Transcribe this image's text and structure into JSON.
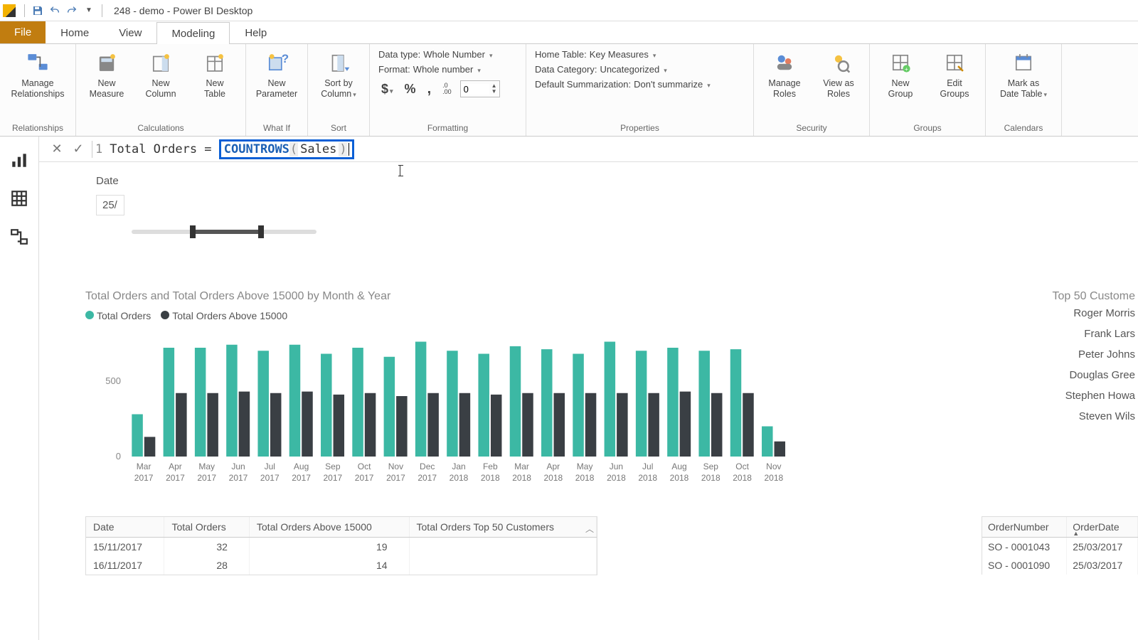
{
  "title": "248 - demo - Power BI Desktop",
  "menu": {
    "file": "File",
    "tabs": [
      "Home",
      "View",
      "Modeling",
      "Help"
    ],
    "active": "Modeling"
  },
  "ribbon": {
    "relationships": {
      "manage": "Manage\nRelationships",
      "label": "Relationships"
    },
    "calculations": {
      "measure": "New\nMeasure",
      "column": "New\nColumn",
      "table": "New\nTable",
      "label": "Calculations"
    },
    "whatif": {
      "param": "New\nParameter",
      "label": "What If"
    },
    "sort": {
      "sortby": "Sort by\nColumn",
      "label": "Sort"
    },
    "formatting": {
      "datatype_lbl": "Data type:",
      "datatype_val": "Whole Number",
      "format_lbl": "Format:",
      "format_val": "Whole number",
      "currency": "$",
      "percent": "%",
      "comma": ",",
      "dec_icon": ".0\n.00",
      "dec_val": "0",
      "label": "Formatting"
    },
    "properties": {
      "home_lbl": "Home Table:",
      "home_val": "Key Measures",
      "cat_lbl": "Data Category:",
      "cat_val": "Uncategorized",
      "sum_lbl": "Default Summarization:",
      "sum_val": "Don't summarize",
      "label": "Properties"
    },
    "security": {
      "manage": "Manage\nRoles",
      "view": "View as\nRoles",
      "label": "Security"
    },
    "groups": {
      "new": "New\nGroup",
      "edit": "Edit\nGroups",
      "label": "Groups"
    },
    "calendars": {
      "mark": "Mark as\nDate Table",
      "label": "Calendars"
    }
  },
  "formula": {
    "line": "1",
    "prefix": "Total Orders =",
    "fn": "COUNTROWS",
    "arg": "Sales"
  },
  "slicer": {
    "label": "Date",
    "value": "25/"
  },
  "chart_data": {
    "type": "bar",
    "title": "Total Orders and Total Orders Above 15000 by Month & Year",
    "series": [
      {
        "name": "Total Orders",
        "color": "#3cb8a4"
      },
      {
        "name": "Total Orders Above 15000",
        "color": "#3a3f44"
      }
    ],
    "categories": [
      "Mar 2017",
      "Apr 2017",
      "May 2017",
      "Jun 2017",
      "Jul 2017",
      "Aug 2017",
      "Sep 2017",
      "Oct 2017",
      "Nov 2017",
      "Dec 2017",
      "Jan 2018",
      "Feb 2018",
      "Mar 2018",
      "Apr 2018",
      "May 2018",
      "Jun 2018",
      "Jul 2018",
      "Aug 2018",
      "Sep 2018",
      "Oct 2018",
      "Nov 2018"
    ],
    "values": [
      [
        280,
        130
      ],
      [
        720,
        420
      ],
      [
        720,
        420
      ],
      [
        740,
        430
      ],
      [
        700,
        420
      ],
      [
        740,
        430
      ],
      [
        680,
        410
      ],
      [
        720,
        420
      ],
      [
        660,
        400
      ],
      [
        760,
        420
      ],
      [
        700,
        420
      ],
      [
        680,
        410
      ],
      [
        730,
        420
      ],
      [
        710,
        420
      ],
      [
        680,
        420
      ],
      [
        760,
        420
      ],
      [
        700,
        420
      ],
      [
        720,
        430
      ],
      [
        700,
        420
      ],
      [
        710,
        420
      ],
      [
        200,
        100
      ]
    ],
    "ylabel": "",
    "yticks": [
      0,
      500
    ],
    "ylim": [
      0,
      800
    ]
  },
  "table_left": {
    "cols": [
      "Date",
      "Total Orders",
      "Total Orders Above 15000",
      "Total Orders Top 50 Customers"
    ],
    "rows": [
      [
        "15/11/2017",
        "32",
        "19",
        ""
      ],
      [
        "16/11/2017",
        "28",
        "14",
        ""
      ]
    ]
  },
  "right_panel": {
    "title": "Top 50 Custome",
    "customers": [
      "Roger Morris",
      "Frank Lars",
      "Peter Johns",
      "Douglas Gree",
      "Stephen Howa",
      "Steven Wils"
    ]
  },
  "table_right": {
    "cols": [
      "OrderNumber",
      "OrderDate"
    ],
    "rows": [
      [
        "SO - 0001043",
        "25/03/2017"
      ],
      [
        "SO - 0001090",
        "25/03/2017"
      ]
    ]
  }
}
